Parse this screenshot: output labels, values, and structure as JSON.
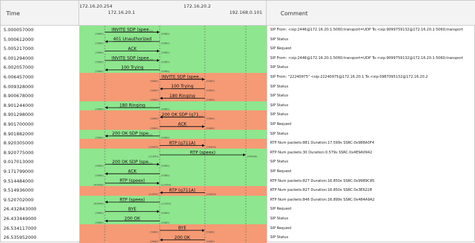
{
  "headers": {
    "time": "Time",
    "comment": "Comment"
  },
  "hosts": [
    "172.16.20.254",
    "172.16.20.1",
    "172.16.20.2",
    "192.168.0.101"
  ],
  "colors": {
    "green": "#8ee68e",
    "orange": "#f59a74",
    "white": "#ffffff"
  },
  "rows": [
    {
      "time": "5.000057000",
      "bg": "green",
      "from": 0,
      "to": 1,
      "label": "INVITE SDP (spee...",
      "src_port": "(5060)",
      "dst_port": "(5060)",
      "comment": "SIP From: <sip:2446@172.16.20.1:5060;transport=UDP To:<sip:9099759132@172.16.20.1:5060;transport"
    },
    {
      "time": "5.000612000",
      "bg": "green",
      "from": 1,
      "to": 0,
      "label": "401 Unauthorized",
      "src_port": "(5060)",
      "dst_port": "(5060)",
      "comment": "SIP Status"
    },
    {
      "time": "5.005217000",
      "bg": "green",
      "from": 0,
      "to": 1,
      "label": "ACK",
      "src_port": "(5060)",
      "dst_port": "(5060)",
      "comment": "SIP Request"
    },
    {
      "time": "6.001294000",
      "bg": "green",
      "from": 0,
      "to": 1,
      "label": "INVITE SDP (spee...",
      "src_port": "(5060)",
      "dst_port": "(5060)",
      "comment": "SIP From: <sip:2446@172.16.20.1:5060;transport=UDP To:<sip:9099759132@172.16.20.1:5060;transport"
    },
    {
      "time": "6.002057000",
      "bg": "green",
      "from": 1,
      "to": 0,
      "label": "100 Trying",
      "src_port": "(5060)",
      "dst_port": "(5060)",
      "comment": "SIP Status"
    },
    {
      "time": "6.006457000",
      "bg": "orange",
      "from": 1,
      "to": 2,
      "label": "INVITE SDP (spee...",
      "src_port": "(5060)",
      "dst_port": "(5060)",
      "comment": "SIP From: \"22240975\" <sip:22240975@172.16.20.1 To:<sip:0987095132@172.16.20.2"
    },
    {
      "time": "6.009328000",
      "bg": "orange",
      "from": 2,
      "to": 1,
      "label": "100 Trying",
      "src_port": "(5060)",
      "dst_port": "(5060)",
      "comment": "SIP Status"
    },
    {
      "time": "8.900678000",
      "bg": "orange",
      "from": 2,
      "to": 1,
      "label": "180 Ringing",
      "src_port": "(5060)",
      "dst_port": "(5060)",
      "comment": "SIP Status"
    },
    {
      "time": "8.901244000",
      "bg": "green",
      "from": 1,
      "to": 0,
      "label": "180 Ringing",
      "src_port": "(5060)",
      "dst_port": "(5060)",
      "comment": "SIP Status"
    },
    {
      "time": "8.901298000",
      "bg": "orange",
      "from": 2,
      "to": 1,
      "label": "200 OK SDP (g71...",
      "src_port": "(5060)",
      "dst_port": "(5060)",
      "comment": "SIP Status"
    },
    {
      "time": "8.901700000",
      "bg": "orange",
      "from": 1,
      "to": 2,
      "label": "ACK",
      "src_port": "(5060)",
      "dst_port": "(5060)",
      "comment": "SIP Request"
    },
    {
      "time": "8.901882000",
      "bg": "green",
      "from": 1,
      "to": 0,
      "label": "200 OK SDP (spe...",
      "src_port": "(5060)",
      "dst_port": "(5060)",
      "comment": "SIP Status"
    },
    {
      "time": "8.920305000",
      "bg": "orange",
      "from": 1,
      "to": 2,
      "label": "RTP (g711A)",
      "src_port": "(14950)",
      "dst_port": "(16400)",
      "comment": "RTP Num packets:881  Duration:17.599s SSRC:0x988A0F4"
    },
    {
      "time": "8.920775000",
      "bg": "green",
      "from": 1,
      "to": 3,
      "label": "RTP (speex)",
      "src_port": "(11950)",
      "dst_port": "(40098)",
      "comment": "RTP Num packets:30  Duration:0.579s SSRC:0x4E9A0942"
    },
    {
      "time": "9.017013000",
      "bg": "green",
      "from": 0,
      "to": 1,
      "label": "200 OK SDP (spe...",
      "src_port": "(5060)",
      "dst_port": "(5060)",
      "comment": "SIP Status"
    },
    {
      "time": "9.171799000",
      "bg": "green",
      "from": 1,
      "to": 0,
      "label": "ACK",
      "src_port": "(5060)",
      "dst_port": "(5060)",
      "comment": "SIP Request"
    },
    {
      "time": "9.514484000",
      "bg": "green",
      "from": 0,
      "to": 1,
      "label": "RTP (speex)",
      "src_port": "(40098)",
      "dst_port": "(11950)",
      "comment": "RTP Num packets:827  Duration:16.850s SSRC:0x9989C85"
    },
    {
      "time": "9.514936000",
      "bg": "orange",
      "from": 2,
      "to": 1,
      "label": "RTP (g711A)",
      "src_port": "(16400)",
      "dst_port": "(14950)",
      "comment": "RTP Num packets:827  Duration:16.850s SSRC:0x3E6228"
    },
    {
      "time": "9.520702000",
      "bg": "green",
      "from": 1,
      "to": 0,
      "label": "RTP (speex)",
      "src_port": "(11950)",
      "dst_port": "(40098)",
      "comment": "RTP Num packets:846  Duration:16.899s SSRC:0x484A9A2"
    },
    {
      "time": "26.432843000",
      "bg": "green",
      "from": 0,
      "to": 1,
      "label": "BYE",
      "src_port": "(5060)",
      "dst_port": "(5060)",
      "comment": "SIP Request"
    },
    {
      "time": "26.433449000",
      "bg": "green",
      "from": 1,
      "to": 0,
      "label": "200 OK",
      "src_port": "(5060)",
      "dst_port": "(5060)",
      "comment": "SIP Status"
    },
    {
      "time": "26.534117000",
      "bg": "orange",
      "from": 1,
      "to": 2,
      "label": "BYE",
      "src_port": "(5060)",
      "dst_port": "(5060)",
      "comment": "SIP Request"
    },
    {
      "time": "26.535952000",
      "bg": "orange",
      "from": 2,
      "to": 1,
      "label": "200 OK",
      "src_port": "(5060)",
      "dst_port": "(5060)",
      "comment": "SIP Status"
    }
  ]
}
